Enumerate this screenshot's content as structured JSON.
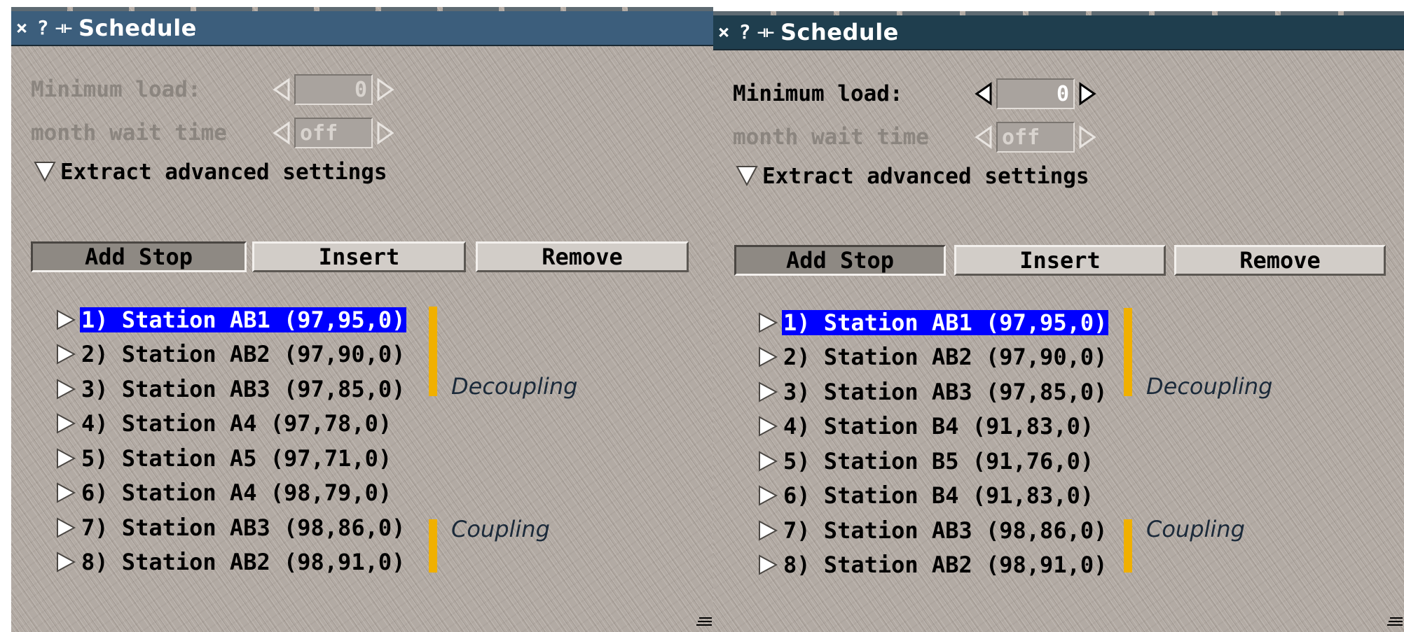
{
  "colors": {
    "title_bar_left": "#3c5e7c",
    "title_bar_right": "#1f3e4e",
    "selection": "#0000ff",
    "group_bar": "#f0b000",
    "panel_background": "#b2aaa3"
  },
  "windows": [
    {
      "title_bar": {
        "close_icon": "×",
        "help_icon": "?",
        "pin_icon": "⊣⊢",
        "title": "Schedule"
      },
      "settings": {
        "minimum_load_label": "Minimum load:",
        "minimum_load_value": "0",
        "month_wait_label": "month wait time",
        "month_wait_value": "off",
        "extract_label": "Extract advanced settings"
      },
      "buttons": {
        "add_stop": "Add Stop",
        "insert": "Insert",
        "remove": "Remove"
      },
      "stops": [
        {
          "label": "1) Station AB1 (97,95,0)",
          "selected": true
        },
        {
          "label": "2) Station AB2 (97,90,0)",
          "selected": false
        },
        {
          "label": "3) Station AB3 (97,85,0)",
          "selected": false
        },
        {
          "label": "4) Station A4 (97,78,0)",
          "selected": false
        },
        {
          "label": "5) Station A5 (97,71,0)",
          "selected": false
        },
        {
          "label": "6) Station A4 (98,79,0)",
          "selected": false
        },
        {
          "label": "7) Station AB3 (98,86,0)",
          "selected": false
        },
        {
          "label": "8) Station AB2 (98,91,0)",
          "selected": false
        }
      ],
      "annotations": {
        "decoupling": "Decoupling",
        "coupling": "Coupling"
      }
    },
    {
      "title_bar": {
        "close_icon": "×",
        "help_icon": "?",
        "pin_icon": "⊣⊢",
        "title": "Schedule"
      },
      "settings": {
        "minimum_load_label": "Minimum load:",
        "minimum_load_value": "0",
        "month_wait_label": "month wait time",
        "month_wait_value": "off",
        "extract_label": "Extract advanced settings"
      },
      "buttons": {
        "add_stop": "Add Stop",
        "insert": "Insert",
        "remove": "Remove"
      },
      "stops": [
        {
          "label": "1) Station AB1 (97,95,0)",
          "selected": true
        },
        {
          "label": "2) Station AB2 (97,90,0)",
          "selected": false
        },
        {
          "label": "3) Station AB3 (97,85,0)",
          "selected": false
        },
        {
          "label": "4) Station B4 (91,83,0)",
          "selected": false
        },
        {
          "label": "5) Station B5 (91,76,0)",
          "selected": false
        },
        {
          "label": "6) Station B4 (91,83,0)",
          "selected": false
        },
        {
          "label": "7) Station AB3 (98,86,0)",
          "selected": false
        },
        {
          "label": "8) Station AB2 (98,91,0)",
          "selected": false
        }
      ],
      "annotations": {
        "decoupling": "Decoupling",
        "coupling": "Coupling"
      }
    }
  ]
}
